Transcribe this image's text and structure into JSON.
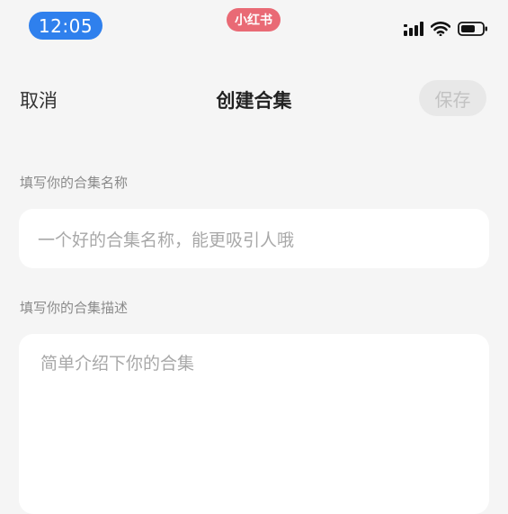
{
  "status_bar": {
    "time": "12:05",
    "brand": "小红书",
    "icons": [
      "signal-icon",
      "wifi-icon",
      "battery-icon"
    ]
  },
  "nav": {
    "cancel_label": "取消",
    "title": "创建合集",
    "save_label": "保存"
  },
  "form": {
    "name_label": "填写你的合集名称",
    "name_placeholder": "一个好的合集名称，能更吸引人哦",
    "desc_label": "填写你的合集描述",
    "desc_placeholder": "简单介绍下你的合集"
  },
  "colors": {
    "background": "#f5f5f5",
    "time_pill": "#2f80ed",
    "brand_badge": "#e96a75",
    "save_disabled_bg": "#e8e8e8",
    "save_disabled_text": "#c2c2c2"
  }
}
